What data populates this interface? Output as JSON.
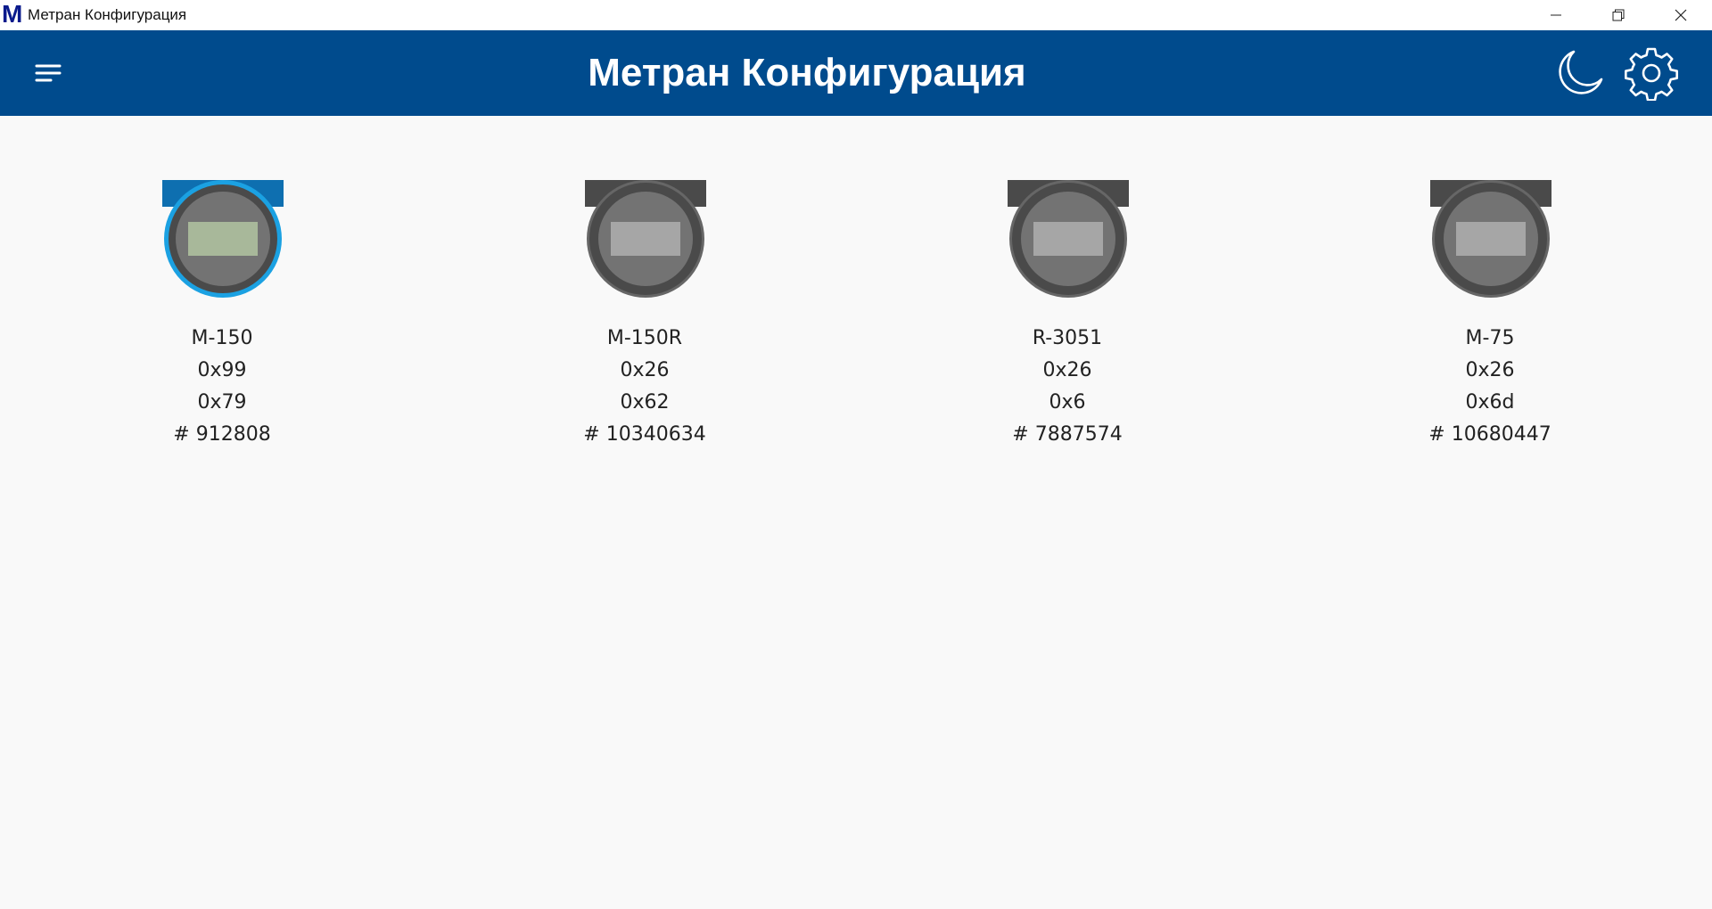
{
  "window": {
    "logo": "M",
    "title": "Метран Конфигурация",
    "controls": {
      "minimize_icon": "minimize-icon",
      "restore_icon": "restore-icon",
      "close_icon": "close-icon"
    }
  },
  "header": {
    "title": "Метран Конфигурация",
    "menu_icon": "hamburger-menu-icon",
    "theme_icon": "moon-icon",
    "settings_icon": "gear-icon",
    "background_color": "#004b8d"
  },
  "devices": [
    {
      "model": "M-150",
      "code1": "0x99",
      "code2": "0x79",
      "serial": "# 912808",
      "selected": true
    },
    {
      "model": "M-150R",
      "code1": "0x26",
      "code2": "0x62",
      "serial": "# 10340634",
      "selected": false
    },
    {
      "model": "R-3051",
      "code1": "0x26",
      "code2": "0x6",
      "serial": "# 7887574",
      "selected": false
    },
    {
      "model": "M-75",
      "code1": "0x26",
      "code2": "0x6d",
      "serial": "# 10680447",
      "selected": false
    }
  ],
  "colors": {
    "selected_ring": "#1ba1e2",
    "selected_bar": "#0e6fb0",
    "device_body": "#4a4a4a",
    "device_inner": "#737373",
    "display_selected": "#a8b89a",
    "display_default": "#a6a6a6"
  }
}
